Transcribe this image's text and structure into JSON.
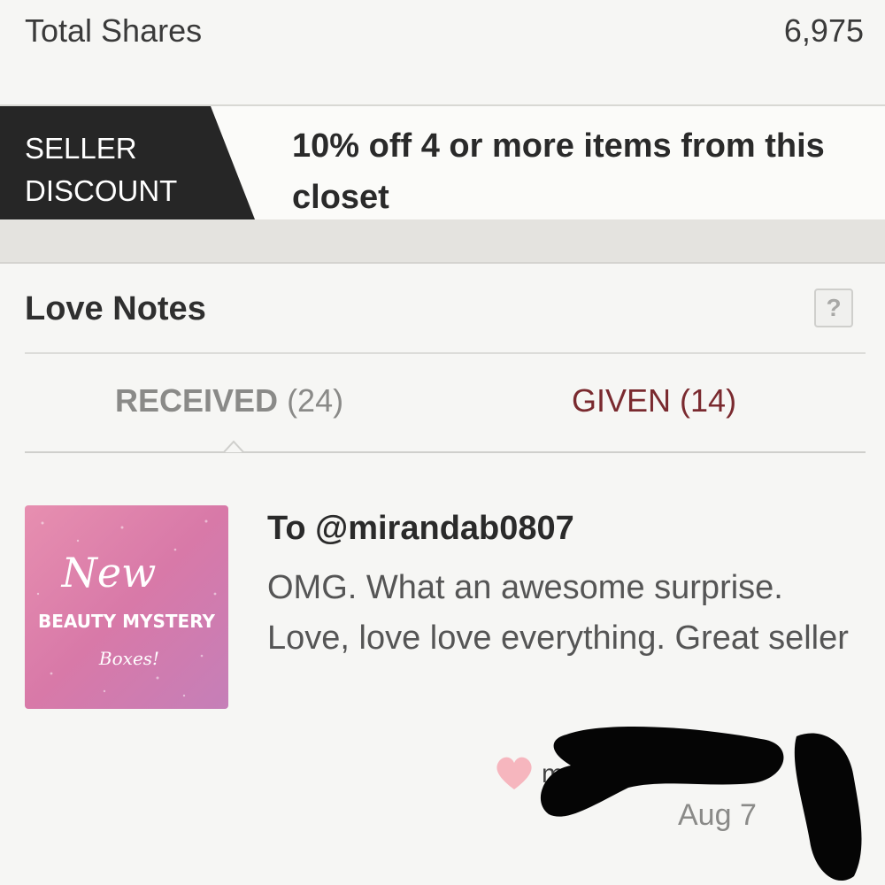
{
  "stats": {
    "total_shares_label": "Total Shares",
    "total_shares_value": "6,975"
  },
  "seller_discount": {
    "badge_line1": "SELLER",
    "badge_line2": "DISCOUNT",
    "text": "10% off 4 or more items from this closet"
  },
  "love_notes": {
    "title": "Love Notes",
    "help_label": "?",
    "tabs": [
      {
        "label": "RECEIVED",
        "count": "(24)",
        "active": true
      },
      {
        "label": "GIVEN",
        "count": "(14)",
        "active": false
      }
    ],
    "notes": [
      {
        "thumbnail_text": {
          "line1": "New",
          "line2": "BEAUTY MYSTERY",
          "line3": "Boxes!"
        },
        "to": "To @mirandab0807",
        "message": "OMG. What an awesome surprise. Love, love love everything. Great seller",
        "author_partial": "m",
        "date": "Aug 7",
        "icon": "heart-icon"
      }
    ]
  },
  "colors": {
    "badge_bg": "#262626",
    "given_tab": "#7a2a2f",
    "heart": "#f6b6be"
  }
}
